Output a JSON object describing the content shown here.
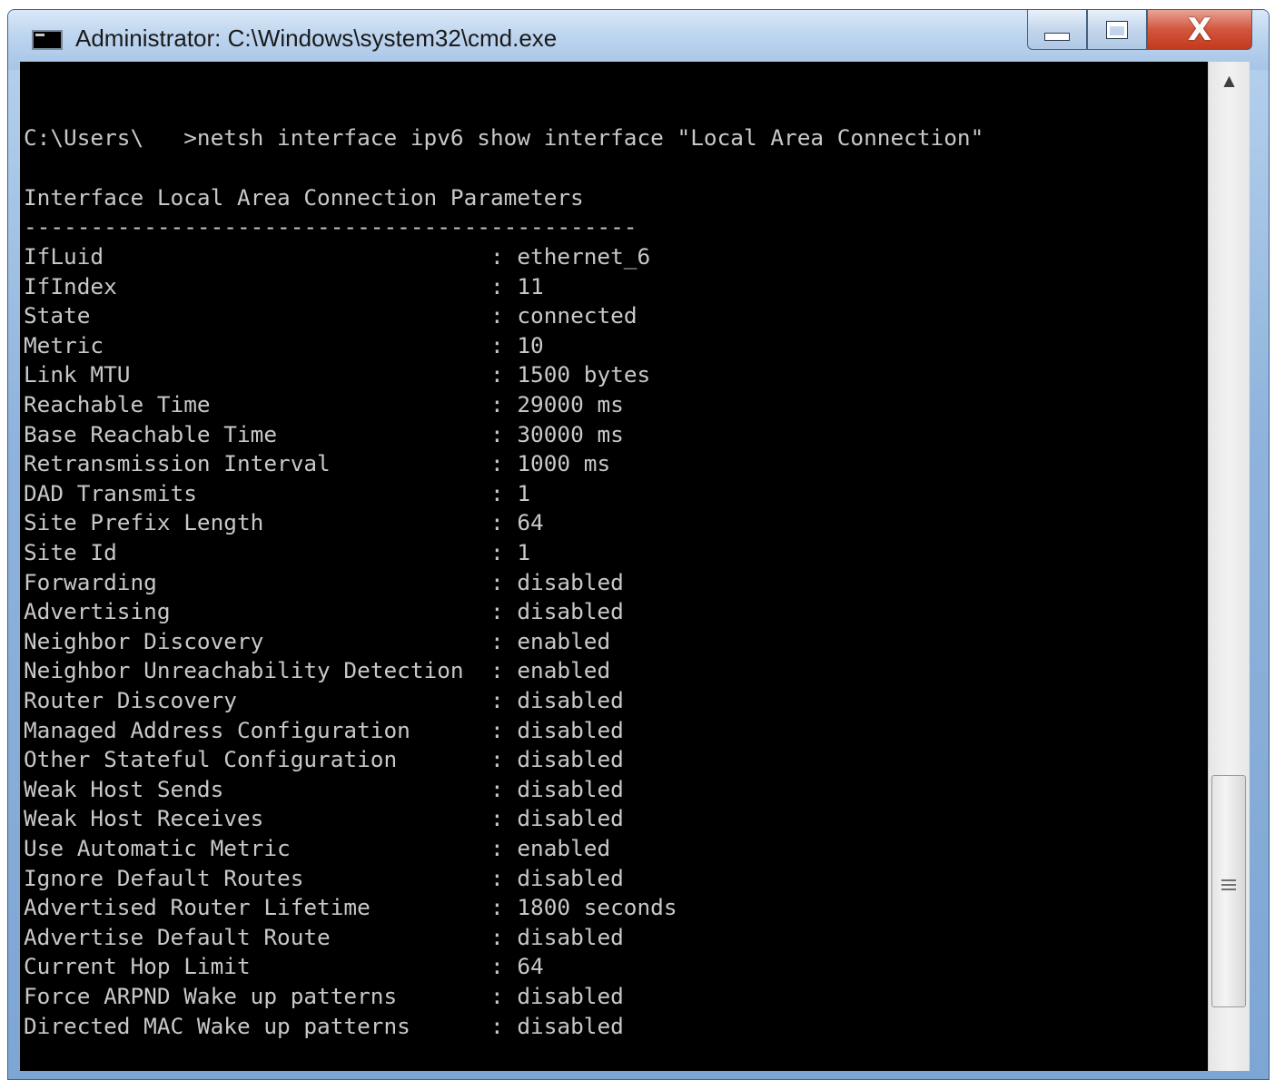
{
  "window": {
    "title": "Administrator: C:\\Windows\\system32\\cmd.exe",
    "icon": "cmd-app-icon",
    "controls": {
      "minimize": "minimize-icon",
      "maximize": "maximize-icon",
      "close": "close-icon",
      "close_glyph": "X"
    }
  },
  "console": {
    "command": "C:\\Users\\   >netsh interface ipv6 show interface \"Local Area Connection\"",
    "header": "Interface Local Area Connection Parameters",
    "separator": "----------------------------------------------",
    "rows": [
      {
        "key": "IfLuid",
        "value": "ethernet_6"
      },
      {
        "key": "IfIndex",
        "value": "11"
      },
      {
        "key": "State",
        "value": "connected"
      },
      {
        "key": "Metric",
        "value": "10"
      },
      {
        "key": "Link MTU",
        "value": "1500 bytes"
      },
      {
        "key": "Reachable Time",
        "value": "29000 ms"
      },
      {
        "key": "Base Reachable Time",
        "value": "30000 ms"
      },
      {
        "key": "Retransmission Interval",
        "value": "1000 ms"
      },
      {
        "key": "DAD Transmits",
        "value": "1"
      },
      {
        "key": "Site Prefix Length",
        "value": "64"
      },
      {
        "key": "Site Id",
        "value": "1"
      },
      {
        "key": "Forwarding",
        "value": "disabled"
      },
      {
        "key": "Advertising",
        "value": "disabled"
      },
      {
        "key": "Neighbor Discovery",
        "value": "enabled"
      },
      {
        "key": "Neighbor Unreachability Detection",
        "value": "enabled"
      },
      {
        "key": "Router Discovery",
        "value": "disabled"
      },
      {
        "key": "Managed Address Configuration",
        "value": "disabled"
      },
      {
        "key": "Other Stateful Configuration",
        "value": "disabled"
      },
      {
        "key": "Weak Host Sends",
        "value": "disabled"
      },
      {
        "key": "Weak Host Receives",
        "value": "disabled"
      },
      {
        "key": "Use Automatic Metric",
        "value": "enabled"
      },
      {
        "key": "Ignore Default Routes",
        "value": "disabled"
      },
      {
        "key": "Advertised Router Lifetime",
        "value": "1800 seconds"
      },
      {
        "key": "Advertise Default Route",
        "value": "disabled"
      },
      {
        "key": "Current Hop Limit",
        "value": "64"
      },
      {
        "key": "Force ARPND Wake up patterns",
        "value": "disabled"
      },
      {
        "key": "Directed MAC Wake up patterns",
        "value": "disabled"
      }
    ]
  },
  "scrollbar": {
    "up_arrow": "scroll-up-arrow-icon",
    "grip": "scroll-grip-icon",
    "position": 0.78
  },
  "colors": {
    "console_bg": "#000000",
    "console_text": "#c8c8c8",
    "close_button": "#c43a1e"
  }
}
